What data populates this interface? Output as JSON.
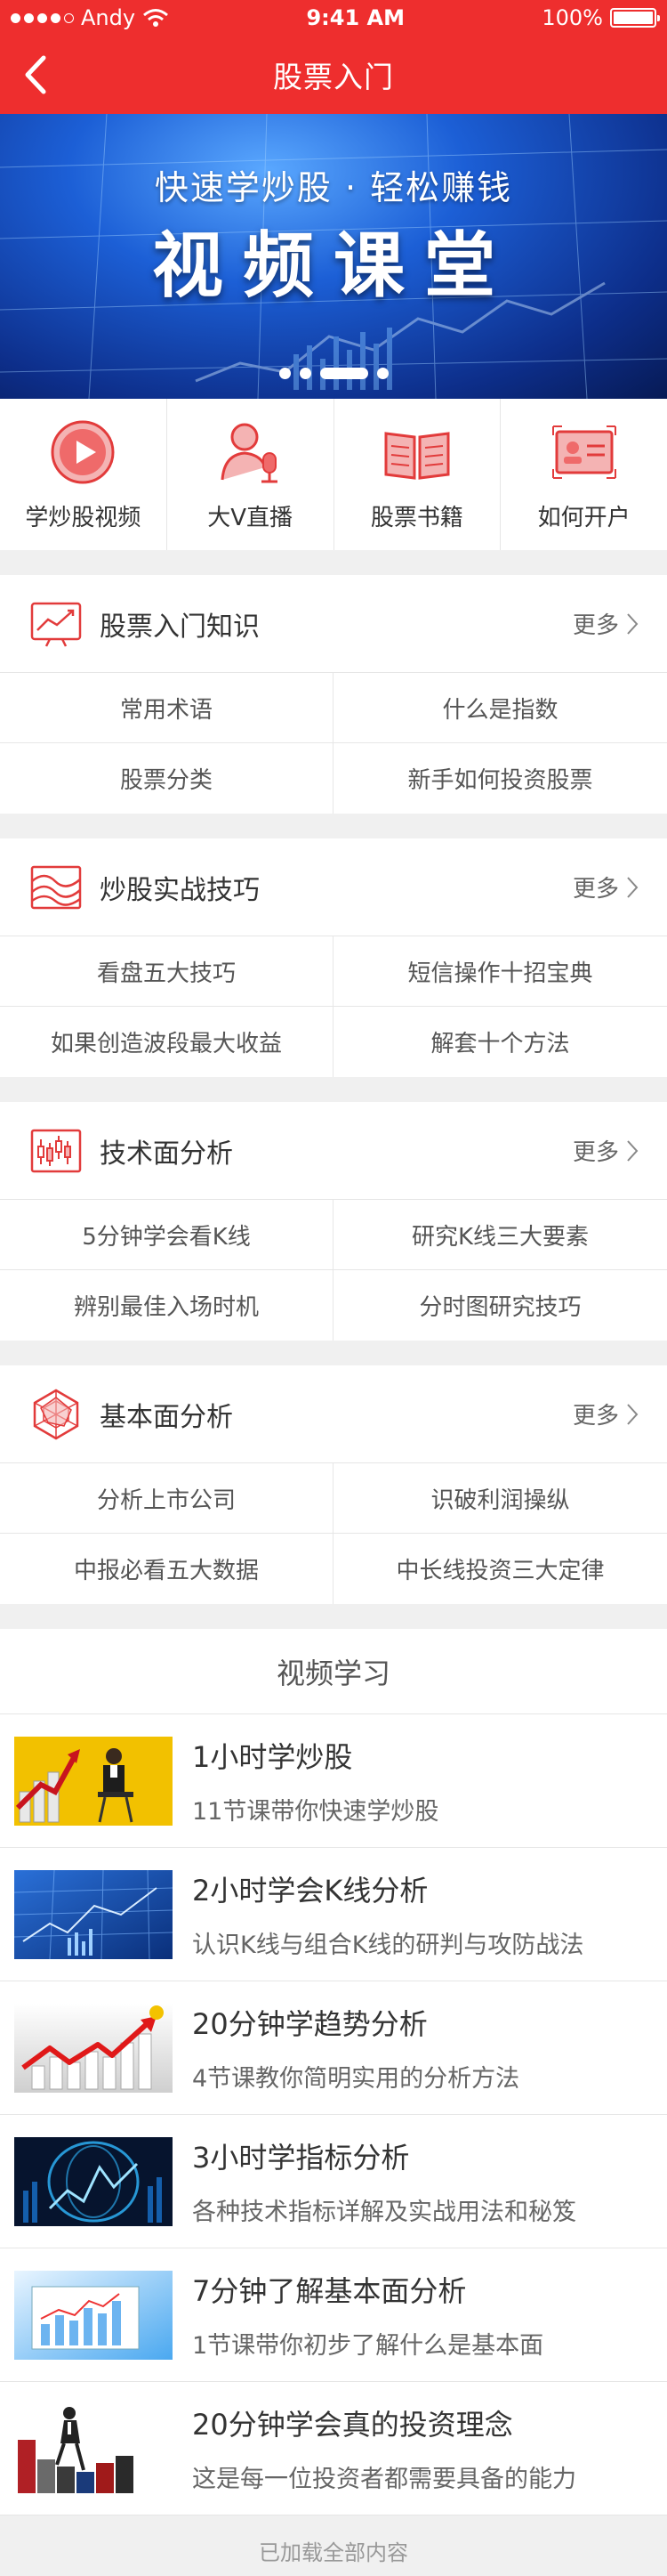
{
  "status": {
    "carrier": "Andy",
    "time": "9:41 AM",
    "battery": "100%"
  },
  "nav": {
    "title": "股票入门"
  },
  "banner": {
    "subtitle": "快速学炒股 · 轻松赚钱",
    "title": "视频课堂",
    "slides": 4,
    "active_slide": 2
  },
  "quicknav": [
    {
      "label": "学炒股视频",
      "icon": "play-circle-icon"
    },
    {
      "label": "大V直播",
      "icon": "microphone-person-icon"
    },
    {
      "label": "股票书籍",
      "icon": "open-book-icon"
    },
    {
      "label": "如何开户",
      "icon": "id-card-icon"
    }
  ],
  "sections": [
    {
      "title": "股票入门知识",
      "icon": "trend-chart-icon",
      "more": "更多",
      "items": [
        "常用术语",
        "什么是指数",
        "股票分类",
        "新手如何投资股票"
      ]
    },
    {
      "title": "炒股实战技巧",
      "icon": "wave-chart-icon",
      "more": "更多",
      "items": [
        "看盘五大技巧",
        "短信操作十招宝典",
        "如果创造波段最大收益",
        "解套十个方法"
      ]
    },
    {
      "title": "技术面分析",
      "icon": "candlestick-icon",
      "more": "更多",
      "items": [
        "5分钟学会看K线",
        "研究K线三大要素",
        "辨别最佳入场时机",
        "分时图研究技巧"
      ]
    },
    {
      "title": "基本面分析",
      "icon": "radar-chart-icon",
      "more": "更多",
      "items": [
        "分析上市公司",
        "识破利润操纵",
        "中报必看五大数据",
        "中长线投资三大定律"
      ]
    }
  ],
  "videos": {
    "heading": "视频学习",
    "items": [
      {
        "title": "1小时学炒股",
        "desc": "11节课带你快速学炒股"
      },
      {
        "title": "2小时学会K线分析",
        "desc": "认识K线与组合K线的研判与攻防战法"
      },
      {
        "title": "20分钟学趋势分析",
        "desc": "4节课教你简明实用的分析方法"
      },
      {
        "title": "3小时学指标分析",
        "desc": "各种技术指标详解及实战用法和秘笈"
      },
      {
        "title": "7分钟了解基本面分析",
        "desc": "1节课带你初步了解什么是基本面"
      },
      {
        "title": "20分钟学会真的投资理念",
        "desc": "这是每一位投资者都需要具备的能力"
      }
    ]
  },
  "footer": "已加载全部内容",
  "colors": {
    "accent": "#ee2e2e",
    "background": "#f0f0f0"
  }
}
